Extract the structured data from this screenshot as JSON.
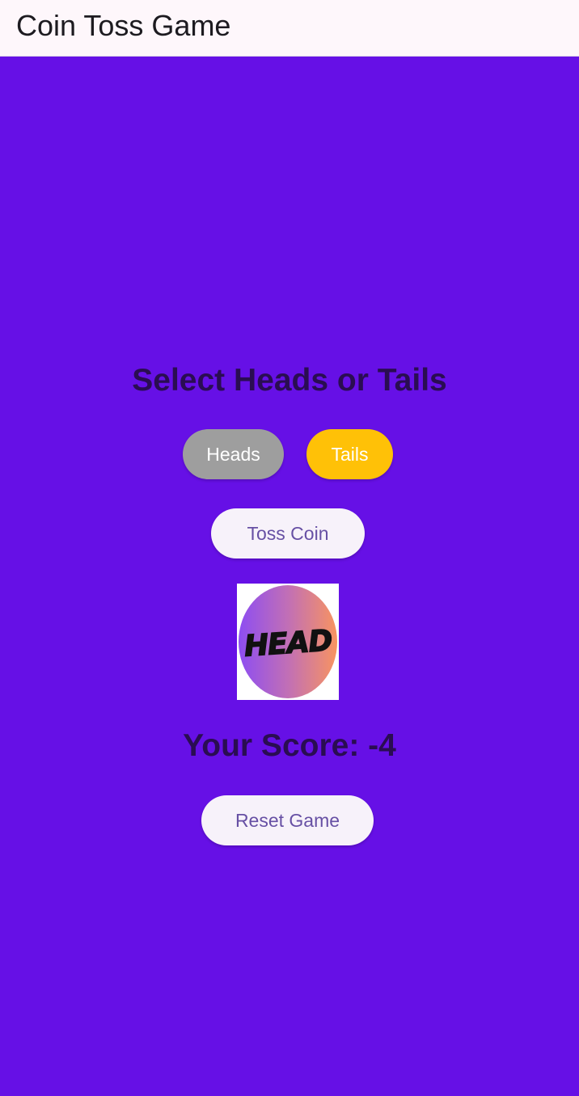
{
  "app_bar": {
    "title": "Coin Toss Game"
  },
  "main": {
    "prompt": "Select Heads or Tails",
    "choices": {
      "heads_label": "Heads",
      "tails_label": "Tails",
      "selected": "Tails"
    },
    "toss_label": "Toss Coin",
    "coin": {
      "face_text": "HEAD",
      "icon": "coin-head-icon"
    },
    "score_text": "Your Score: -4",
    "reset_label": "Reset Game"
  },
  "colors": {
    "background": "#6610e6",
    "app_bar": "#fef7fb",
    "heads_button": "#9e9e9e",
    "tails_button_selected": "#ffc107",
    "action_button": "#f7f2fa",
    "action_text": "#6750a4",
    "heading_text": "#2a0d52"
  }
}
